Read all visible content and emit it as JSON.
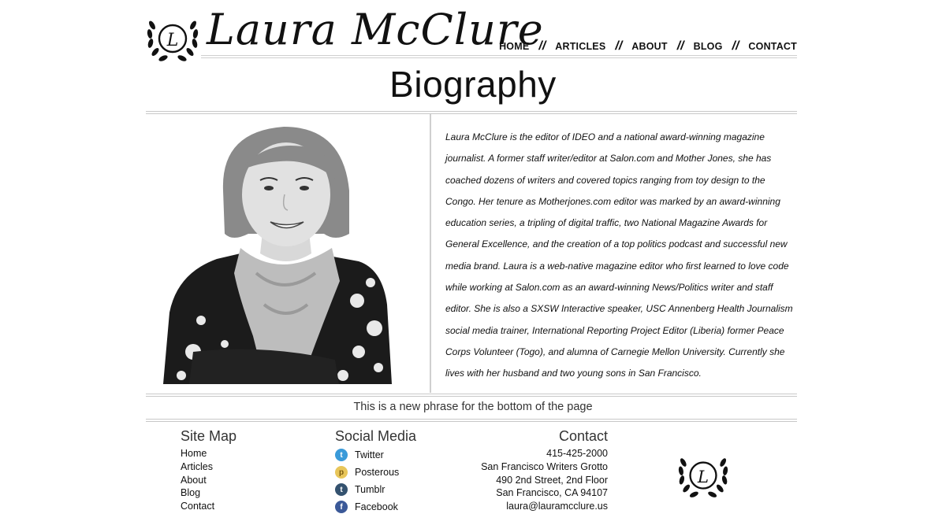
{
  "header": {
    "site_name": "Laura McClure",
    "logo_letter": "L",
    "nav": [
      {
        "label": "HOME"
      },
      {
        "label": "ARTICLES"
      },
      {
        "label": "ABOUT"
      },
      {
        "label": "BLOG"
      },
      {
        "label": "CONTACT"
      }
    ],
    "nav_separator": "//"
  },
  "page": {
    "title": "Biography",
    "bio": "Laura McClure is the editor of IDEO and a national award-winning magazine journalist. A former staff writer/editor at Salon.com and Mother Jones, she has coached dozens of writers and covered topics ranging from toy design to the Congo. Her tenure as Motherjones.com editor was marked by an award-winning education series, a tripling of digital traffic, two National Magazine Awards for General Excellence, and the creation of a top politics podcast and successful new media brand. Laura is a web-native magazine editor who first learned to love code while working at Salon.com as an award-winning News/Politics writer and staff editor. She is also a SXSW Interactive speaker, USC Annenberg Health Journalism social media trainer, International Reporting Project Editor (Liberia) former Peace Corps Volunteer (Togo), and alumna of Carnegie Mellon University. Currently she lives with her husband and two young sons in San Francisco.",
    "tagline": "This is a new phrase for the bottom of the page"
  },
  "footer": {
    "sitemap": {
      "heading": "Site Map",
      "links": [
        "Home",
        "Articles",
        "About",
        "Blog",
        "Contact"
      ]
    },
    "social": {
      "heading": "Social Media",
      "links": [
        {
          "label": "Twitter",
          "icon": "twitter-icon",
          "glyph": "t",
          "color": "#3a9ad9"
        },
        {
          "label": "Posterous",
          "icon": "posterous-icon",
          "glyph": "p",
          "color": "#e8c65a"
        },
        {
          "label": "Tumblr",
          "icon": "tumblr-icon",
          "glyph": "t",
          "color": "#34526f"
        },
        {
          "label": "Facebook",
          "icon": "facebook-icon",
          "glyph": "f",
          "color": "#3b5998"
        }
      ]
    },
    "contact": {
      "heading": "Contact",
      "phone": "415-425-2000",
      "org": "San Francisco Writers Grotto",
      "street": "490 2nd Street, 2nd Floor",
      "city": "San Francisco, CA 94107",
      "email": "laura@lauramcclure.us"
    }
  }
}
